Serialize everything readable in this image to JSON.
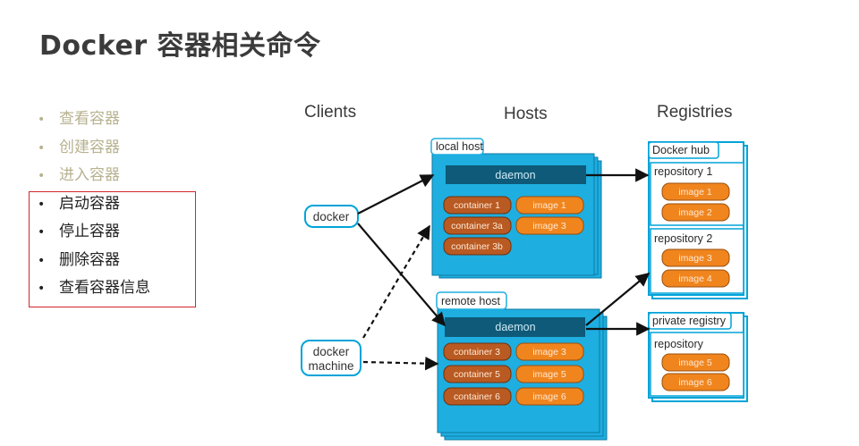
{
  "slide": {
    "title": "Docker 容器相关命令",
    "bullets": [
      {
        "text": "查看容器",
        "state": "muted"
      },
      {
        "text": "创建容器",
        "state": "muted"
      },
      {
        "text": "进入容器",
        "state": "muted"
      },
      {
        "text": "启动容器",
        "state": "active"
      },
      {
        "text": "停止容器",
        "state": "active"
      },
      {
        "text": "删除容器",
        "state": "active"
      },
      {
        "text": "查看容器信息",
        "state": "active"
      }
    ],
    "bullet_symbol": "•"
  },
  "diagram": {
    "headers": {
      "clients": "Clients",
      "hosts": "Hosts",
      "registries": "Registries"
    },
    "clients": {
      "docker": "docker",
      "machine_line1": "docker",
      "machine_line2": "machine"
    },
    "local_host": {
      "label": "local host",
      "daemon": "daemon",
      "containers": [
        "container 1",
        "container 3a",
        "container 3b"
      ],
      "images": [
        "image 1",
        "image 3"
      ]
    },
    "remote_host": {
      "label": "remote host",
      "daemon": "daemon",
      "containers": [
        "container 3",
        "container 5",
        "container 6"
      ],
      "images": [
        "image 3",
        "image 5",
        "image 6"
      ]
    },
    "docker_hub": {
      "label": "Docker hub",
      "repo1": {
        "label": "repository 1",
        "images": [
          "image 1",
          "image 2"
        ]
      },
      "repo2": {
        "label": "repository 2",
        "images": [
          "image 3",
          "image 4"
        ]
      }
    },
    "private_registry": {
      "label": "private registry",
      "repo": {
        "label": "repository",
        "images": [
          "image 5",
          "image 6"
        ]
      }
    },
    "colors": {
      "host_fill": "#1eaee0",
      "host_stroke": "#0d7aa3",
      "daemon_fill": "#0e5a78",
      "container_fill": "#b85a22",
      "image_fill": "#f0851e",
      "box_stroke": "#00a3d9",
      "highlight": "#d2262b",
      "muted_text": "#b7b28f"
    }
  }
}
